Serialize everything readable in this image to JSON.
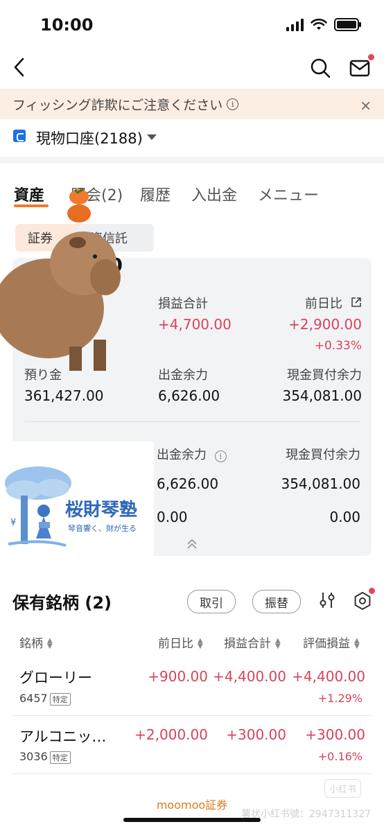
{
  "status_bar": {
    "time": "10:00"
  },
  "banner": {
    "text": "フィッシング詐欺にご注意ください",
    "info_icon": "i",
    "close_icon": "×"
  },
  "account": {
    "label": "現物口座(2188)"
  },
  "tabs": [
    {
      "label": "資産",
      "active": true
    },
    {
      "label": "照会(2)"
    },
    {
      "label": "履歴"
    },
    {
      "label": "入出金"
    },
    {
      "label": "メニュー"
    }
  ],
  "sub_tabs": [
    {
      "label": "証券"
    },
    {
      "label": "投資信託"
    }
  ],
  "summary": {
    "total_partial": "00",
    "pnl_total_label": "損益合計",
    "pnl_total_value": "+4,700.00",
    "day_change_label": "前日比",
    "day_change_value": "+2,900.00",
    "day_change_pct": "+0.33%",
    "deposit_label": "預り金",
    "deposit_value": "361,427.00",
    "withdrawable_label": "出金余力",
    "withdrawable_value": "6,626.00",
    "cash_buying_label": "現金買付余力",
    "cash_buying_value": "354,081.00"
  },
  "detail": {
    "withdrawable_label": "出金余力",
    "cash_buying_label": "現金買付余力",
    "withdrawable_value": "6,626.00",
    "cash_buying_value": "354,081.00",
    "row2_left": "0.00",
    "row2_right": "0.00"
  },
  "logo": {
    "title": "桜財琴塾",
    "subtitle": "琴音響く、財が生る"
  },
  "holdings": {
    "title": "保有銘柄 (2)",
    "trade_button": "取引",
    "transfer_button": "振替",
    "columns": [
      "銘柄",
      "前日比",
      "損益合計",
      "評価損益"
    ],
    "rows": [
      {
        "name": "グローリー",
        "code": "6457",
        "tag": "特定",
        "day_change": "+900.00",
        "pnl_total": "+4,400.00",
        "eval_pnl": "+4,400.00",
        "eval_pct": "+1.29%"
      },
      {
        "name": "アルコニッ…",
        "code": "3036",
        "tag": "特定",
        "day_change": "+2,000.00",
        "pnl_total": "+300.00",
        "eval_pnl": "+300.00",
        "eval_pct": "+0.16%"
      }
    ]
  },
  "footer": {
    "brand": "moomoo証券"
  },
  "watermark": {
    "text": "薯状小红书號：2947311327",
    "badge": "小红书"
  },
  "colors": {
    "accent": "#f07a2a",
    "positive": "#d8435a",
    "account_icon": "#1e70e6"
  }
}
